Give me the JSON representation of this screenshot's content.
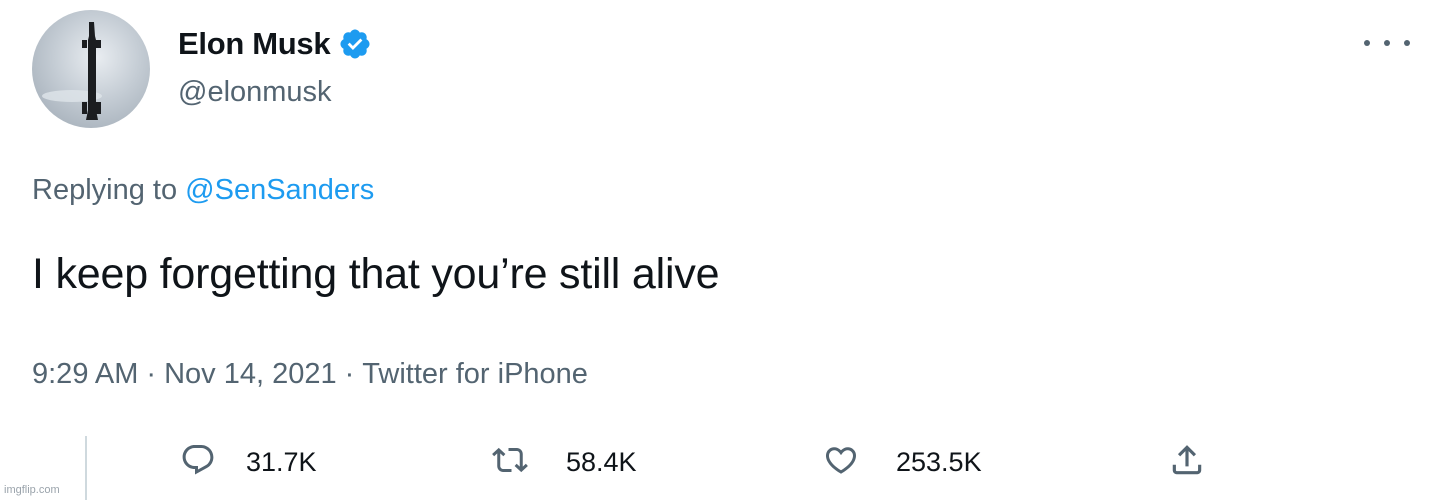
{
  "author": {
    "display_name": "Elon Musk",
    "handle": "@elonmusk",
    "verified": true
  },
  "reply_context": {
    "prefix": "Replying to",
    "mention": "@SenSanders"
  },
  "tweet": {
    "text": "I keep forgetting that you’re still alive"
  },
  "meta": {
    "time": "9:29 AM",
    "separator": "·",
    "date": "Nov 14, 2021",
    "source": "Twitter for iPhone"
  },
  "actions": {
    "replies": "31.7K",
    "retweets": "58.4K",
    "likes": "253.5K"
  },
  "icons": {
    "reply": "reply-icon",
    "retweet": "retweet-icon",
    "like": "heart-icon",
    "share": "share-icon",
    "more": "more-icon",
    "verified": "verified-badge-icon"
  },
  "colors": {
    "link": "#1d9bf0",
    "secondary_text": "#536471",
    "primary_text": "#0f1419",
    "verified": "#1d9bf0"
  },
  "watermark": "imgflip.com"
}
